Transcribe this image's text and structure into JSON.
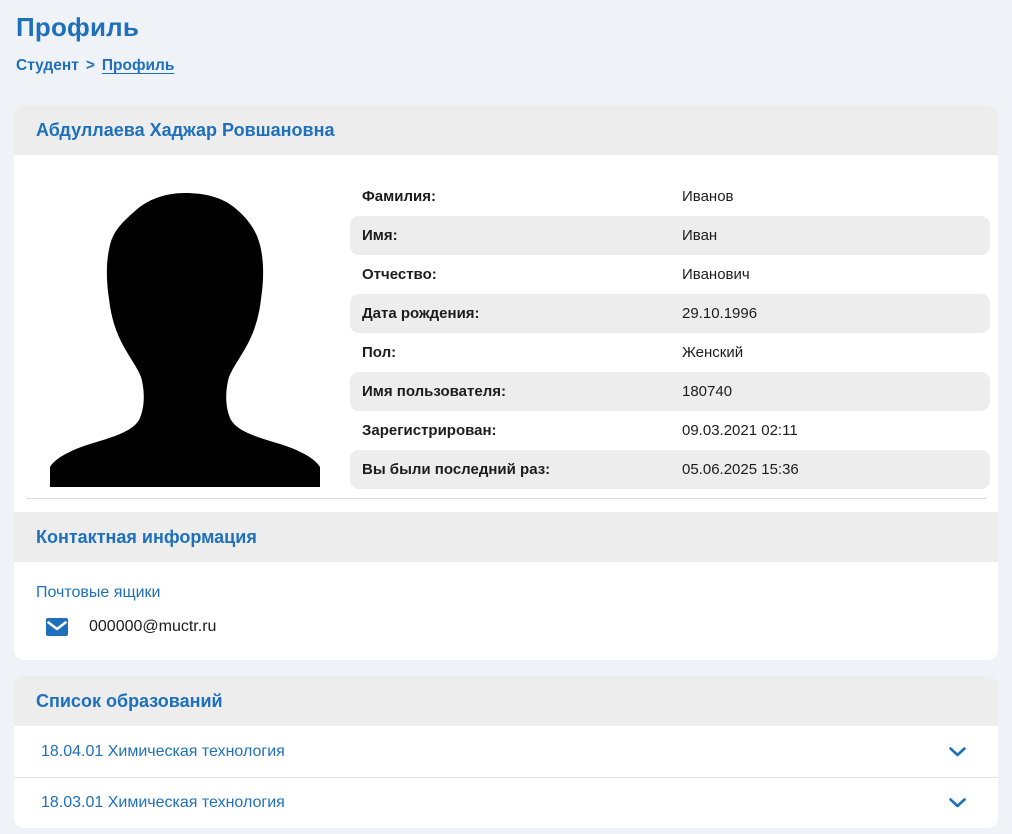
{
  "page": {
    "title": "Профиль",
    "breadcrumb": {
      "parent": "Студент",
      "separator": ">",
      "current": "Профиль"
    }
  },
  "profile": {
    "full_name": "Абдуллаева Хаджар Ровшановна",
    "photo": "black-silhouette-placeholder",
    "fields": [
      {
        "label": "Фамилия:",
        "value": "Иванов"
      },
      {
        "label": "Имя:",
        "value": "Иван"
      },
      {
        "label": "Отчество:",
        "value": "Иванович"
      },
      {
        "label": "Дата рождения:",
        "value": "29.10.1996"
      },
      {
        "label": "Пол:",
        "value": "Женский"
      },
      {
        "label": "Имя пользователя:",
        "value": "180740"
      },
      {
        "label": "Зарегистрирован:",
        "value": "09.03.2021 02:11"
      },
      {
        "label": "Вы были последний раз:",
        "value": "05.06.2025 15:36"
      }
    ]
  },
  "contact": {
    "section_title": "Контактная информация",
    "mailboxes_label": "Почтовые ящики",
    "emails": [
      {
        "icon": "mail-icon",
        "address": "000000@muctr.ru"
      }
    ]
  },
  "education": {
    "section_title": "Список образований",
    "items": [
      {
        "label": "18.04.01 Химическая технология",
        "icon": "chevron-down-icon"
      },
      {
        "label": "18.03.01 Химическая технология",
        "icon": "chevron-down-icon"
      }
    ]
  },
  "colors": {
    "accent_blue": "#1e70bc",
    "header_band_bg": "#ededed",
    "row_stripe_bg": "#ededee",
    "page_bg": "#eff2f6",
    "card_bg": "#ffffff"
  }
}
